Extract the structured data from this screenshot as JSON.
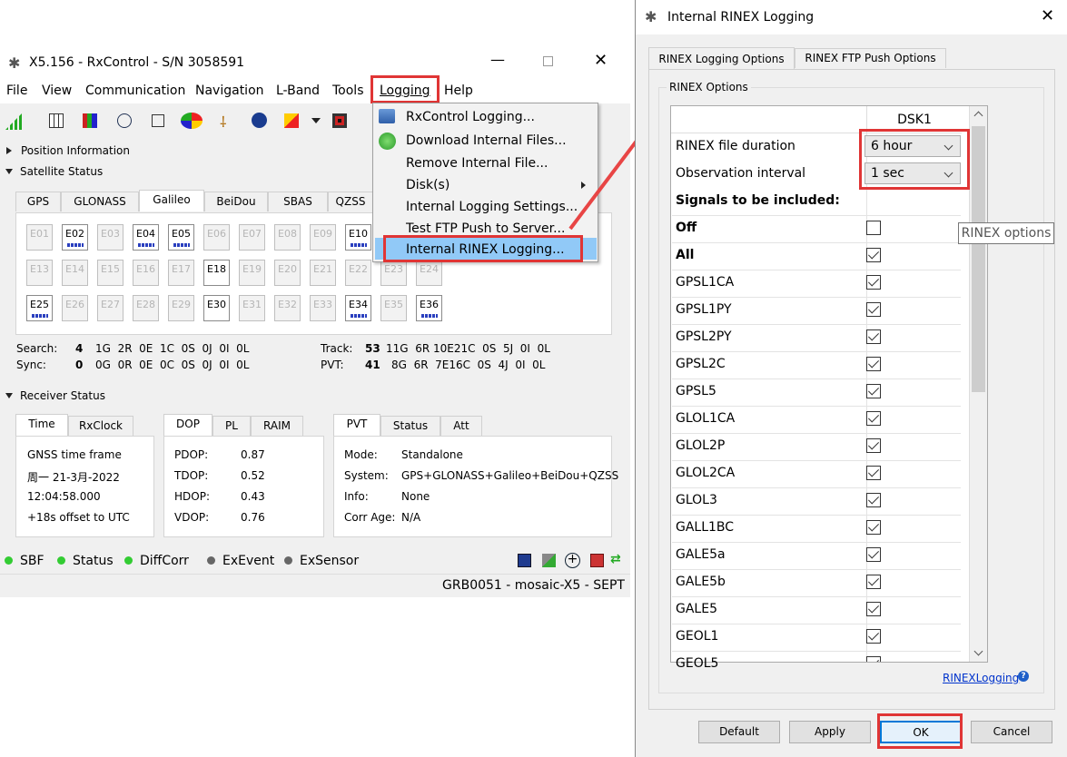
{
  "main_window": {
    "title": "X5.156 - RxControl - S/N 3058591",
    "menu": [
      "File",
      "View",
      "Communication",
      "Navigation",
      "L-Band",
      "Tools",
      "Logging",
      "Help"
    ],
    "sections": {
      "position": "Position Information",
      "satellite": "Satellite Status",
      "receiver": "Receiver Status"
    },
    "sat_tabs": [
      "GPS",
      "GLONASS",
      "Galileo",
      "BeiDou",
      "SBAS",
      "QZSS"
    ],
    "satellites_row1": [
      "E01",
      "E02",
      "E03",
      "E04",
      "E05",
      "E06",
      "E07",
      "E08",
      "E09",
      "E10"
    ],
    "satellites_row2": [
      "E13",
      "E14",
      "E15",
      "E16",
      "E17",
      "E18",
      "E19",
      "E20",
      "E21",
      "E22",
      "E23",
      "E24"
    ],
    "satellites_row3": [
      "E25",
      "E26",
      "E27",
      "E28",
      "E29",
      "E30",
      "E31",
      "E32",
      "E33",
      "E34",
      "E35",
      "E36"
    ],
    "search": {
      "label": "Search:",
      "count": "4",
      "values": "1G  2R  0E  1C  0S  0J  0I  0L"
    },
    "sync": {
      "label": "Sync:",
      "count": "0",
      "values": "0G  0R  0E  0C  0S  0J  0I  0L"
    },
    "track": {
      "label": "Track:",
      "count": "53",
      "values": "11G  6R 10E21C  0S  5J  0I  0L"
    },
    "pvt": {
      "label": "PVT:",
      "count": "41",
      "values": "8G  6R  7E16C  0S  4J  0I  0L"
    },
    "time_tabs": [
      "Time",
      "RxClock"
    ],
    "time_lines": [
      "GNSS time frame",
      "周一 21-3月-2022",
      "12:04:58.000",
      "+18s offset to UTC"
    ],
    "dop_tabs": [
      "DOP",
      "PL",
      "RAIM"
    ],
    "dop": [
      {
        "k": "PDOP:",
        "v": "0.87"
      },
      {
        "k": "TDOP:",
        "v": "0.52"
      },
      {
        "k": "HDOP:",
        "v": "0.43"
      },
      {
        "k": "VDOP:",
        "v": "0.76"
      }
    ],
    "pvt_tabs": [
      "PVT",
      "Status",
      "Att"
    ],
    "pvt_info": [
      {
        "k": "Mode:",
        "v": "Standalone"
      },
      {
        "k": "System:",
        "v": "GPS+GLONASS+Galileo+BeiDou+QZSS"
      },
      {
        "k": "Info:",
        "v": "None"
      },
      {
        "k": "Corr Age:",
        "v": "N/A"
      }
    ],
    "status_items": [
      "SBF",
      "Status",
      "DiffCorr",
      "ExEvent",
      "ExSensor"
    ],
    "footer": "GRB0051 - mosaic-X5 - SEPT"
  },
  "logging_menu": {
    "items": [
      "RxControl Logging...",
      "Download Internal Files...",
      "Remove Internal File...",
      "Disk(s)",
      "Internal Logging Settings...",
      "Test FTP Push to Server...",
      "Internal RINEX Logging..."
    ]
  },
  "dialog": {
    "title": "Internal RINEX Logging",
    "tabs": [
      "RINEX Logging Options",
      "RINEX FTP Push Options"
    ],
    "group": "RINEX Options",
    "column_header": "DSK1",
    "file_duration_label": "RINEX file duration",
    "file_duration_value": "6 hour",
    "obs_interval_label": "Observation interval",
    "obs_interval_value": "1 sec",
    "signals_header": "Signals to be included:",
    "signals": [
      {
        "name": "Off",
        "checked": false,
        "bold": true
      },
      {
        "name": "All",
        "checked": true,
        "bold": true
      },
      {
        "name": "GPSL1CA",
        "checked": true
      },
      {
        "name": "GPSL1PY",
        "checked": true
      },
      {
        "name": "GPSL2PY",
        "checked": true
      },
      {
        "name": "GPSL2C",
        "checked": true
      },
      {
        "name": "GPSL5",
        "checked": true
      },
      {
        "name": "GLOL1CA",
        "checked": true
      },
      {
        "name": "GLOL2P",
        "checked": true
      },
      {
        "name": "GLOL2CA",
        "checked": true
      },
      {
        "name": "GLOL3",
        "checked": true
      },
      {
        "name": "GALL1BC",
        "checked": true
      },
      {
        "name": "GALE5a",
        "checked": true
      },
      {
        "name": "GALE5b",
        "checked": true
      },
      {
        "name": "GALE5",
        "checked": true
      },
      {
        "name": "GEOL1",
        "checked": true
      },
      {
        "name": "GEOL5",
        "checked": true
      }
    ],
    "tooltip": "RINEX options",
    "help_link": "RINEXLogging",
    "buttons": {
      "default": "Default",
      "apply": "Apply",
      "ok": "OK",
      "cancel": "Cancel"
    }
  }
}
